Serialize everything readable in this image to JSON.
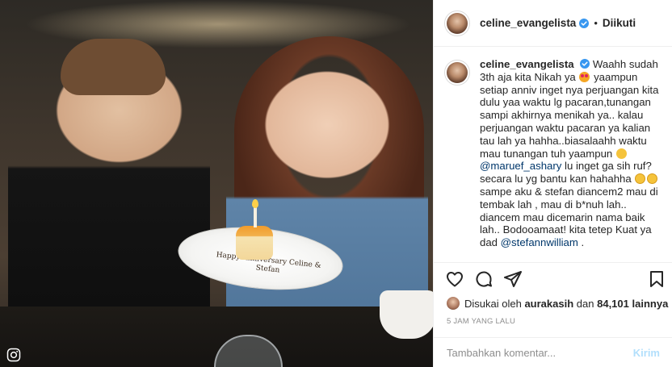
{
  "post": {
    "author": "celine_evangelista",
    "follow_status": "Diikuti",
    "separator": "•",
    "photo_plate_text": "Happy Anniversary Celine & Stefan",
    "watermark_icon": "instagram-glyph-icon"
  },
  "caption": {
    "username": "celine_evangelista",
    "part1": "Waahh sudah 3th aja kita Nikah ya ",
    "part2": " yaampun setiap anniv inget nya perjuangan kita dulu yaa waktu lg pacaran,tunangan sampi akhirnya menikah ya.. kalau perjuangan waktu pacaran ya kalian tau lah ya hahha..biasalaahh waktu mau tunangan tuh yaampun ",
    "mention1": "@maruef_ashary",
    "part3": " lu inget ga sih ruf? secara lu yg bantu kan hahahha ",
    "part4": " sampe aku & stefan diancem2 mau di tembak lah , mau di b*nuh lah.. diancem mau dicemarin nama baik lah.. Bodooamaat! kita tetep Kuat ya dad ",
    "mention2": "@stefannwilliam",
    "part5": " ."
  },
  "likes": {
    "prefix": "Disukai oleh",
    "user": "aurakasih",
    "connector": "dan",
    "count": "84,101",
    "suffix": "lainnya"
  },
  "timestamp": "5 JAM YANG LALU",
  "comment": {
    "placeholder": "Tambahkan komentar...",
    "post_label": "Kirim"
  },
  "colors": {
    "verified": "#3897f0",
    "mention": "#00376b",
    "post_disabled": "#b2dffc",
    "secondary_text": "#8e8e8e"
  }
}
